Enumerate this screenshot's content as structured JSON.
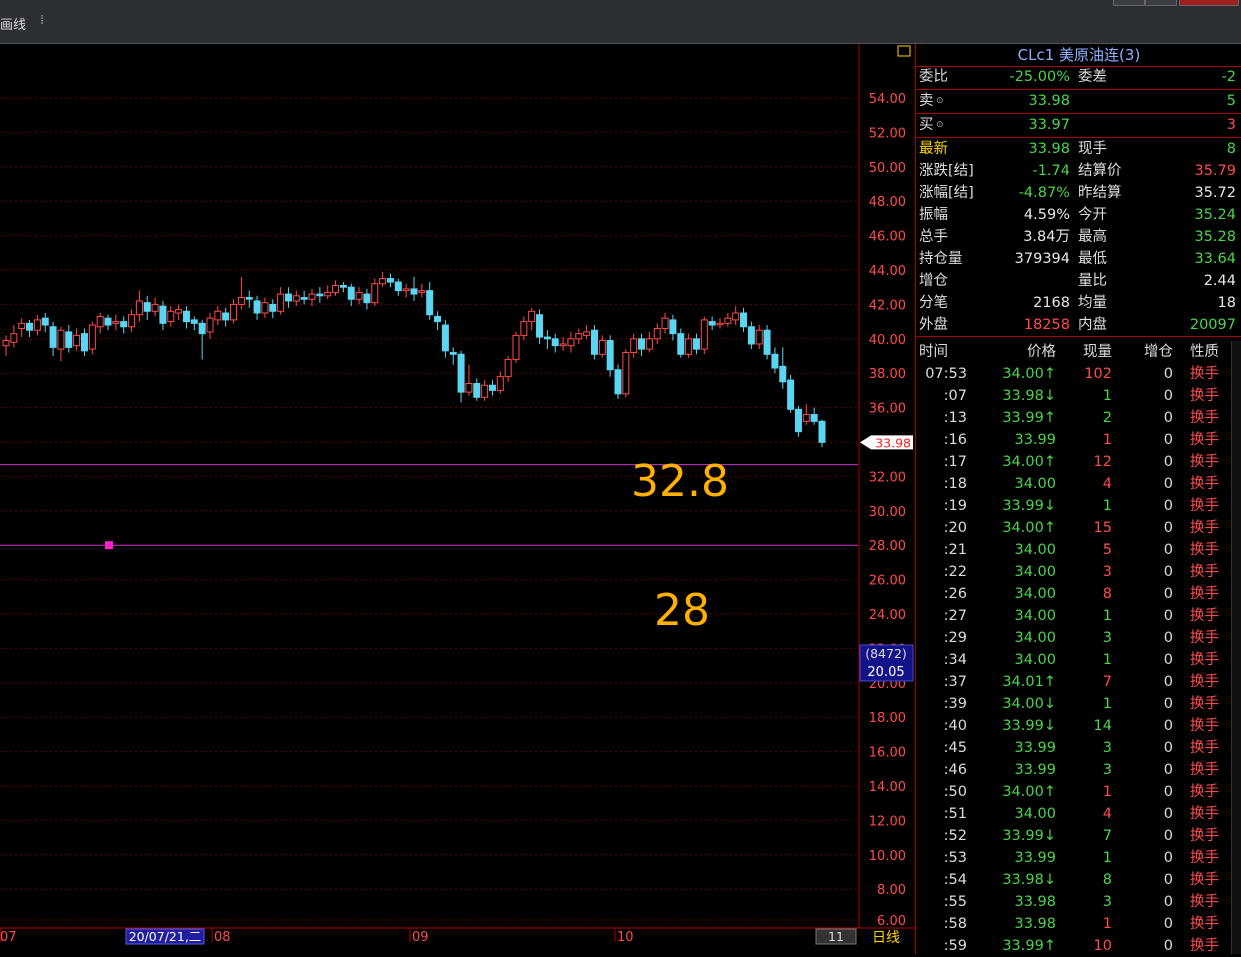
{
  "toolbar": {
    "label": "画线",
    "sep": "⁞"
  },
  "chart_data": {
    "type": "candlestick",
    "ylim": [
      6,
      56
    ],
    "y_ticks": [
      "54.00",
      "52.00",
      "50.00",
      "48.00",
      "46.00",
      "44.00",
      "42.00",
      "40.00",
      "38.00",
      "36.00",
      "34.00",
      "32.00",
      "30.00",
      "28.00",
      "26.00",
      "24.00",
      "22.00",
      "20.00",
      "18.00",
      "16.00",
      "14.00",
      "12.00",
      "10.00",
      "8.00",
      "6.00"
    ],
    "x_labels": [
      "07",
      "08",
      "09",
      "10",
      "11"
    ],
    "cursor_date": "20/07/21,二",
    "period_label": "日线",
    "last_price": "33.98",
    "cursor_box": {
      "line1": "(8472)",
      "line2": "20.05"
    },
    "hlines": [
      {
        "value": 32.8,
        "label": "32.8",
        "color": "#cc33cc"
      },
      {
        "value": 28.0,
        "label": "28",
        "color": "#cc33cc"
      }
    ],
    "candles": [
      [
        39.6,
        39.9,
        39.0,
        40.2
      ],
      [
        39.8,
        40.3,
        39.5,
        40.8
      ],
      [
        40.6,
        40.9,
        40.1,
        41.2
      ],
      [
        40.9,
        40.5,
        40.1,
        41.1
      ],
      [
        40.5,
        41.1,
        40.2,
        41.4
      ],
      [
        41.2,
        40.8,
        40.4,
        41.5
      ],
      [
        40.7,
        39.5,
        39.0,
        41.0
      ],
      [
        39.4,
        40.5,
        38.7,
        40.7
      ],
      [
        40.4,
        39.5,
        39.2,
        40.8
      ],
      [
        39.6,
        40.2,
        39.3,
        40.6
      ],
      [
        40.3,
        39.3,
        39.0,
        40.6
      ],
      [
        39.4,
        40.8,
        39.1,
        41.0
      ],
      [
        40.7,
        41.3,
        40.3,
        41.5
      ],
      [
        41.2,
        40.8,
        40.5,
        41.4
      ],
      [
        40.9,
        41.0,
        40.5,
        41.4
      ],
      [
        41.0,
        40.7,
        40.3,
        41.3
      ],
      [
        40.7,
        41.4,
        40.4,
        41.7
      ],
      [
        41.4,
        42.2,
        41.0,
        42.8
      ],
      [
        42.1,
        41.6,
        41.1,
        42.5
      ],
      [
        41.6,
        42.0,
        41.3,
        42.4
      ],
      [
        41.9,
        40.9,
        40.5,
        42.2
      ],
      [
        41.0,
        41.6,
        40.7,
        41.9
      ],
      [
        41.5,
        41.7,
        41.1,
        42.0
      ],
      [
        41.6,
        41.0,
        40.6,
        41.9
      ],
      [
        41.1,
        40.9,
        40.5,
        41.3
      ],
      [
        40.9,
        40.3,
        38.8,
        41.1
      ],
      [
        40.4,
        41.2,
        40.0,
        41.5
      ],
      [
        41.1,
        41.6,
        40.8,
        41.9
      ],
      [
        41.5,
        41.1,
        40.7,
        41.8
      ],
      [
        41.1,
        42.0,
        40.9,
        42.3
      ],
      [
        42.0,
        42.4,
        41.7,
        43.6
      ],
      [
        42.4,
        42.3,
        41.8,
        42.8
      ],
      [
        42.2,
        41.5,
        41.1,
        42.5
      ],
      [
        41.5,
        42.1,
        41.2,
        42.4
      ],
      [
        42.0,
        41.6,
        41.2,
        42.3
      ],
      [
        41.6,
        42.6,
        41.4,
        43.0
      ],
      [
        42.6,
        42.2,
        41.8,
        43.0
      ],
      [
        42.2,
        42.5,
        41.9,
        42.8
      ],
      [
        42.4,
        42.3,
        42.0,
        42.8
      ],
      [
        42.3,
        42.6,
        41.9,
        42.9
      ],
      [
        42.6,
        42.5,
        42.1,
        43.0
      ],
      [
        42.5,
        42.7,
        42.3,
        43.1
      ],
      [
        42.7,
        43.1,
        42.5,
        43.4
      ],
      [
        43.1,
        43.0,
        42.7,
        43.3
      ],
      [
        43.0,
        42.3,
        41.9,
        43.2
      ],
      [
        42.3,
        42.7,
        42.0,
        43.0
      ],
      [
        42.6,
        42.1,
        41.7,
        42.9
      ],
      [
        42.1,
        43.2,
        41.9,
        43.5
      ],
      [
        43.2,
        43.5,
        43.0,
        43.9
      ],
      [
        43.5,
        43.3,
        43.0,
        43.8
      ],
      [
        43.3,
        42.8,
        42.5,
        43.5
      ],
      [
        42.8,
        42.9,
        42.4,
        43.2
      ],
      [
        42.9,
        42.6,
        42.2,
        43.6
      ],
      [
        42.7,
        42.8,
        42.4,
        43.2
      ],
      [
        42.8,
        41.4,
        41.1,
        43.3
      ],
      [
        41.3,
        41.0,
        40.5,
        41.6
      ],
      [
        40.8,
        39.3,
        38.9,
        41.1
      ],
      [
        39.2,
        39.1,
        38.5,
        39.5
      ],
      [
        39.1,
        36.9,
        36.3,
        39.3
      ],
      [
        36.9,
        37.4,
        36.7,
        38.5
      ],
      [
        37.4,
        36.6,
        36.4,
        37.7
      ],
      [
        36.6,
        37.3,
        36.4,
        37.6
      ],
      [
        37.3,
        37.0,
        36.7,
        37.6
      ],
      [
        37.0,
        37.8,
        36.8,
        38.1
      ],
      [
        37.8,
        38.8,
        37.5,
        39.0
      ],
      [
        38.8,
        40.2,
        38.6,
        40.4
      ],
      [
        40.2,
        41.0,
        39.9,
        41.3
      ],
      [
        41.0,
        41.6,
        40.5,
        41.8
      ],
      [
        41.4,
        40.1,
        39.7,
        41.7
      ],
      [
        40.1,
        40.0,
        39.4,
        40.5
      ],
      [
        40.0,
        39.6,
        39.2,
        40.3
      ],
      [
        39.6,
        39.7,
        39.3,
        40.1
      ],
      [
        39.6,
        40.0,
        39.2,
        40.4
      ],
      [
        40.0,
        40.3,
        39.7,
        40.6
      ],
      [
        40.2,
        40.4,
        40.0,
        40.8
      ],
      [
        40.5,
        39.1,
        38.8,
        40.8
      ],
      [
        39.1,
        39.9,
        38.9,
        40.2
      ],
      [
        39.9,
        38.2,
        37.8,
        40.2
      ],
      [
        38.2,
        36.8,
        36.5,
        38.5
      ],
      [
        36.8,
        39.2,
        36.6,
        39.4
      ],
      [
        39.2,
        40.0,
        38.9,
        40.3
      ],
      [
        40.0,
        39.4,
        39.0,
        40.3
      ],
      [
        39.4,
        40.0,
        39.2,
        40.4
      ],
      [
        40.0,
        40.6,
        39.7,
        40.9
      ],
      [
        40.6,
        41.2,
        40.3,
        41.5
      ],
      [
        41.1,
        40.3,
        39.9,
        41.4
      ],
      [
        40.3,
        39.1,
        38.9,
        40.6
      ],
      [
        39.1,
        40.0,
        38.9,
        40.3
      ],
      [
        40.0,
        39.4,
        39.1,
        40.3
      ],
      [
        39.4,
        41.1,
        39.1,
        41.3
      ],
      [
        41.0,
        40.8,
        40.5,
        41.3
      ],
      [
        40.9,
        40.9,
        40.6,
        41.2
      ],
      [
        40.9,
        41.2,
        40.7,
        41.5
      ],
      [
        41.1,
        41.5,
        40.8,
        41.9
      ],
      [
        41.5,
        40.7,
        40.4,
        41.8
      ],
      [
        40.7,
        39.7,
        39.4,
        41.0
      ],
      [
        39.7,
        40.5,
        39.4,
        40.8
      ],
      [
        40.5,
        39.1,
        38.8,
        40.8
      ],
      [
        39.1,
        38.3,
        38.0,
        39.5
      ],
      [
        38.4,
        37.5,
        37.1,
        39.5
      ],
      [
        37.6,
        35.9,
        35.7,
        37.9
      ],
      [
        35.9,
        34.6,
        34.3,
        36.1
      ],
      [
        35.2,
        35.6,
        35.0,
        36.2
      ],
      [
        35.6,
        35.2,
        35.0,
        36.0
      ],
      [
        35.2,
        33.98,
        33.7,
        35.3
      ]
    ]
  },
  "quote": {
    "title": "CLc1 美原油连(3)",
    "rows": [
      {
        "l1": "委比",
        "v1": "-25.00%",
        "c1": "green",
        "l2": "委差",
        "v2": "-2",
        "c2": "green"
      },
      {
        "l1": "卖",
        "v1": "33.98",
        "c1": "green",
        "l2": "",
        "v2": "5",
        "c2": "green"
      },
      {
        "l1": "买",
        "v1": "33.97",
        "c1": "green",
        "l2": "",
        "v2": "3",
        "c2": "red"
      },
      {
        "l1": "最新",
        "v1": "33.98",
        "c1": "green",
        "l2": "现手",
        "v2": "8",
        "c2": "green"
      },
      {
        "l1": "涨跌[结]",
        "v1": "-1.74",
        "c1": "green",
        "l2": "结算价",
        "v2": "35.79",
        "c2": "red"
      },
      {
        "l1": "涨幅[结]",
        "v1": "-4.87%",
        "c1": "green",
        "l2": "昨结算",
        "v2": "35.72",
        "c2": "white"
      },
      {
        "l1": "振幅",
        "v1": "4.59%",
        "c1": "white",
        "l2": "今开",
        "v2": "35.24",
        "c2": "green"
      },
      {
        "l1": "总手",
        "v1": "3.84万",
        "c1": "white",
        "l2": "最高",
        "v2": "35.28",
        "c2": "green"
      },
      {
        "l1": "持仓量",
        "v1": "379394",
        "c1": "white",
        "l2": "最低",
        "v2": "33.64",
        "c2": "green"
      },
      {
        "l1": "增仓",
        "v1": "",
        "c1": "white",
        "l2": "量比",
        "v2": "2.44",
        "c2": "white"
      },
      {
        "l1": "分笔",
        "v1": "2168",
        "c1": "white",
        "l2": "均量",
        "v2": "18",
        "c2": "white"
      },
      {
        "l1": "外盘",
        "v1": "18258",
        "c1": "red",
        "l2": "内盘",
        "v2": "20097",
        "c2": "green"
      }
    ]
  },
  "ticks": {
    "headers": [
      "时间",
      "价格",
      "现量",
      "增仓",
      "性质"
    ],
    "rows": [
      {
        "t": "07:53",
        "p": "34.00↑",
        "v": "102",
        "vc": "red",
        "oi": "0",
        "n": "换手"
      },
      {
        "t": ":07",
        "p": "33.98↓",
        "v": "1",
        "vc": "green",
        "oi": "0",
        "n": "换手"
      },
      {
        "t": ":13",
        "p": "33.99↑",
        "v": "2",
        "vc": "green",
        "oi": "0",
        "n": "换手"
      },
      {
        "t": ":16",
        "p": "33.99",
        "v": "1",
        "vc": "red",
        "oi": "0",
        "n": "换手"
      },
      {
        "t": ":17",
        "p": "34.00↑",
        "v": "12",
        "vc": "red",
        "oi": "0",
        "n": "换手"
      },
      {
        "t": ":18",
        "p": "34.00",
        "v": "4",
        "vc": "red",
        "oi": "0",
        "n": "换手"
      },
      {
        "t": ":19",
        "p": "33.99↓",
        "v": "1",
        "vc": "green",
        "oi": "0",
        "n": "换手"
      },
      {
        "t": ":20",
        "p": "34.00↑",
        "v": "15",
        "vc": "red",
        "oi": "0",
        "n": "换手"
      },
      {
        "t": ":21",
        "p": "34.00",
        "v": "5",
        "vc": "red",
        "oi": "0",
        "n": "换手"
      },
      {
        "t": ":22",
        "p": "34.00",
        "v": "3",
        "vc": "red",
        "oi": "0",
        "n": "换手"
      },
      {
        "t": ":26",
        "p": "34.00",
        "v": "8",
        "vc": "red",
        "oi": "0",
        "n": "换手"
      },
      {
        "t": ":27",
        "p": "34.00",
        "v": "1",
        "vc": "green",
        "oi": "0",
        "n": "换手"
      },
      {
        "t": ":29",
        "p": "34.00",
        "v": "3",
        "vc": "green",
        "oi": "0",
        "n": "换手"
      },
      {
        "t": ":34",
        "p": "34.00",
        "v": "1",
        "vc": "green",
        "oi": "0",
        "n": "换手"
      },
      {
        "t": ":37",
        "p": "34.01↑",
        "v": "7",
        "vc": "red",
        "oi": "0",
        "n": "换手"
      },
      {
        "t": ":39",
        "p": "34.00↓",
        "v": "1",
        "vc": "green",
        "oi": "0",
        "n": "换手"
      },
      {
        "t": ":40",
        "p": "33.99↓",
        "v": "14",
        "vc": "green",
        "oi": "0",
        "n": "换手"
      },
      {
        "t": ":45",
        "p": "33.99",
        "v": "3",
        "vc": "green",
        "oi": "0",
        "n": "换手"
      },
      {
        "t": ":46",
        "p": "33.99",
        "v": "3",
        "vc": "green",
        "oi": "0",
        "n": "换手"
      },
      {
        "t": ":50",
        "p": "34.00↑",
        "v": "1",
        "vc": "red",
        "oi": "0",
        "n": "换手"
      },
      {
        "t": ":51",
        "p": "34.00",
        "v": "4",
        "vc": "red",
        "oi": "0",
        "n": "换手"
      },
      {
        "t": ":52",
        "p": "33.99↓",
        "v": "7",
        "vc": "green",
        "oi": "0",
        "n": "换手"
      },
      {
        "t": ":53",
        "p": "33.99",
        "v": "1",
        "vc": "green",
        "oi": "0",
        "n": "换手"
      },
      {
        "t": ":54",
        "p": "33.98↓",
        "v": "8",
        "vc": "green",
        "oi": "0",
        "n": "换手"
      },
      {
        "t": ":55",
        "p": "33.98",
        "v": "3",
        "vc": "green",
        "oi": "0",
        "n": "换手"
      },
      {
        "t": ":58",
        "p": "33.98",
        "v": "1",
        "vc": "red",
        "oi": "0",
        "n": "换手"
      },
      {
        "t": ":59",
        "p": "33.99↑",
        "v": "10",
        "vc": "red",
        "oi": "0",
        "n": "换手"
      }
    ]
  },
  "colors": {
    "up": "#ff4b4b",
    "down": "#5bd6f2",
    "grid": "#6b0000",
    "axis": "#b00000"
  }
}
